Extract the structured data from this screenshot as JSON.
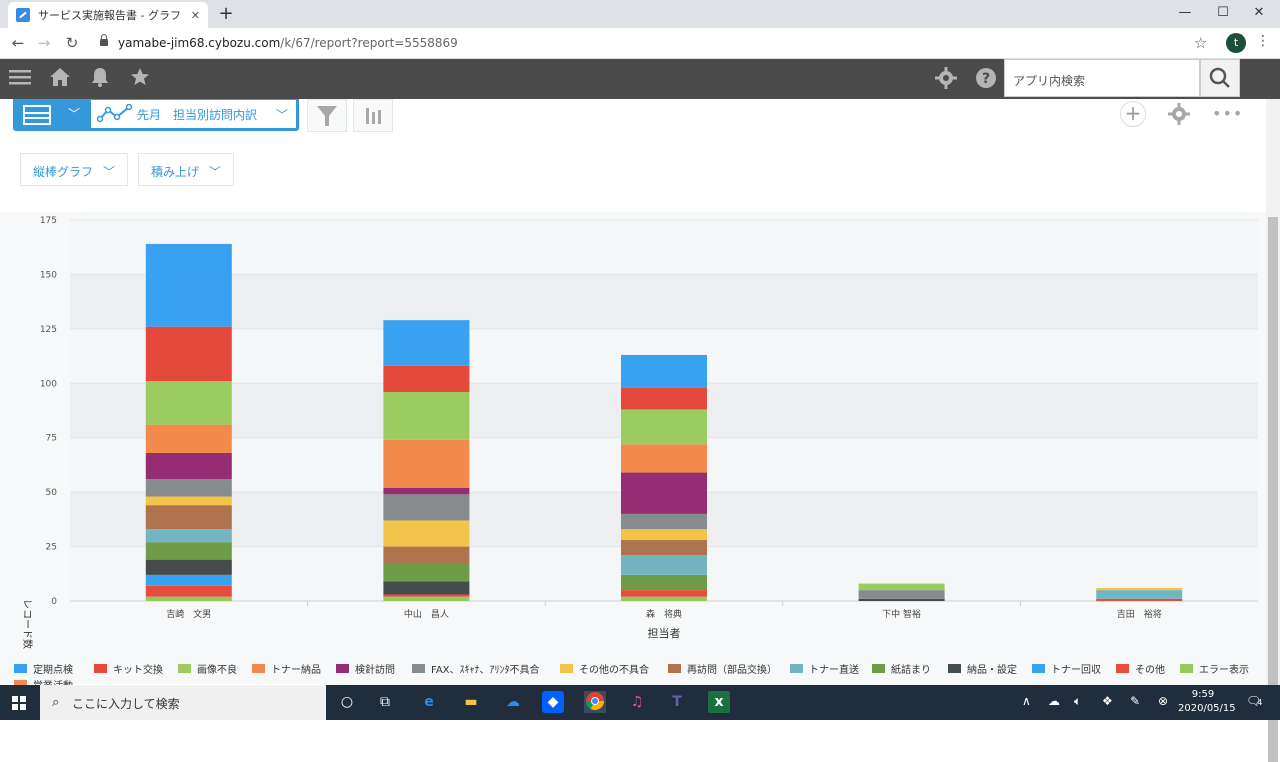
{
  "browser": {
    "tab_title": "サービス実施報告書 - グラフ",
    "tab_close": "✕",
    "new_tab": "+",
    "url_host": "yamabe-jim68.cybozu.com",
    "url_path": "/k/67/report?report=5558869",
    "profile_initial": "t",
    "window_controls": {
      "minimize": "—",
      "maximize": "☐",
      "close": "✕"
    }
  },
  "app_header": {
    "search_placeholder": "アプリ内検索"
  },
  "view_bar": {
    "report_name": "先月　担当別訪問内訳",
    "chart_type_label": "縦棒グラフ",
    "stack_label": "積み上げ"
  },
  "chart_data": {
    "type": "bar",
    "stacked": true,
    "title": "",
    "xlabel": "担当者",
    "ylabel": "レコード数",
    "ylim": [
      0,
      175
    ],
    "yticks": [
      0,
      25,
      50,
      75,
      100,
      125,
      150,
      175
    ],
    "grid": true,
    "legend_position": "bottom",
    "categories": [
      "吉崎　文男",
      "中山　昌人",
      "森　将典",
      "下中 智裕",
      "吉田　裕将"
    ],
    "series": [
      {
        "name": "エラー表示",
        "color": "#95c95b",
        "values": [
          2,
          2,
          2,
          0,
          0
        ]
      },
      {
        "name": "その他",
        "color": "#e74c3c",
        "values": [
          5,
          1,
          3,
          0,
          1
        ]
      },
      {
        "name": "トナー回収",
        "color": "#3aa3f0",
        "values": [
          5,
          0,
          0,
          0,
          0
        ]
      },
      {
        "name": "納品・設定",
        "color": "#444b4d",
        "values": [
          7,
          6,
          0,
          1,
          0
        ]
      },
      {
        "name": "紙詰まり",
        "color": "#6f9a46",
        "values": [
          8,
          8,
          7,
          0,
          0
        ]
      },
      {
        "name": "トナー直送",
        "color": "#72b4c0",
        "values": [
          6,
          0,
          9,
          0,
          4
        ]
      },
      {
        "name": "再訪問（部品交換）",
        "color": "#b0734f",
        "values": [
          11,
          8,
          7,
          0,
          0
        ]
      },
      {
        "name": "その他の不具合",
        "color": "#f2c54a",
        "values": [
          4,
          12,
          5,
          0,
          1
        ]
      },
      {
        "name": "FAX、ｽｷｬﾅ、ｱﾘﾝﾀ不具合",
        "color": "#868b8e",
        "values": [
          8,
          12,
          7,
          4,
          0
        ]
      },
      {
        "name": "検針訪問",
        "color": "#962d72",
        "values": [
          12,
          3,
          19,
          0,
          0
        ]
      },
      {
        "name": "トナー納品",
        "color": "#f28a4c",
        "values": [
          13,
          22,
          13,
          0,
          0
        ]
      },
      {
        "name": "画像不良",
        "color": "#9ccb5f",
        "values": [
          20,
          22,
          16,
          3,
          0
        ]
      },
      {
        "name": "キット交換",
        "color": "#e5493b",
        "values": [
          25,
          12,
          10,
          0,
          0
        ]
      },
      {
        "name": "定期点検",
        "color": "#39a2f0",
        "values": [
          38,
          21,
          15,
          0,
          0
        ]
      },
      {
        "name": "営業活動",
        "color": "#f28a4c",
        "values": [
          0,
          0,
          0,
          0,
          0
        ]
      }
    ],
    "legend_order": [
      "定期点検",
      "キット交換",
      "画像不良",
      "トナー納品",
      "検針訪問",
      "FAX、ｽｷｬﾅ、ｱﾘﾝﾀ不具合",
      "その他の不具合",
      "再訪問（部品交換）",
      "トナー直送",
      "紙詰まり",
      "納品・設定",
      "トナー回収",
      "その他",
      "エラー表示",
      "営業活動"
    ]
  },
  "taskbar": {
    "search_placeholder": "ここに入力して検索",
    "time": "9:59",
    "date": "2020/05/15",
    "notification_count": "4"
  }
}
